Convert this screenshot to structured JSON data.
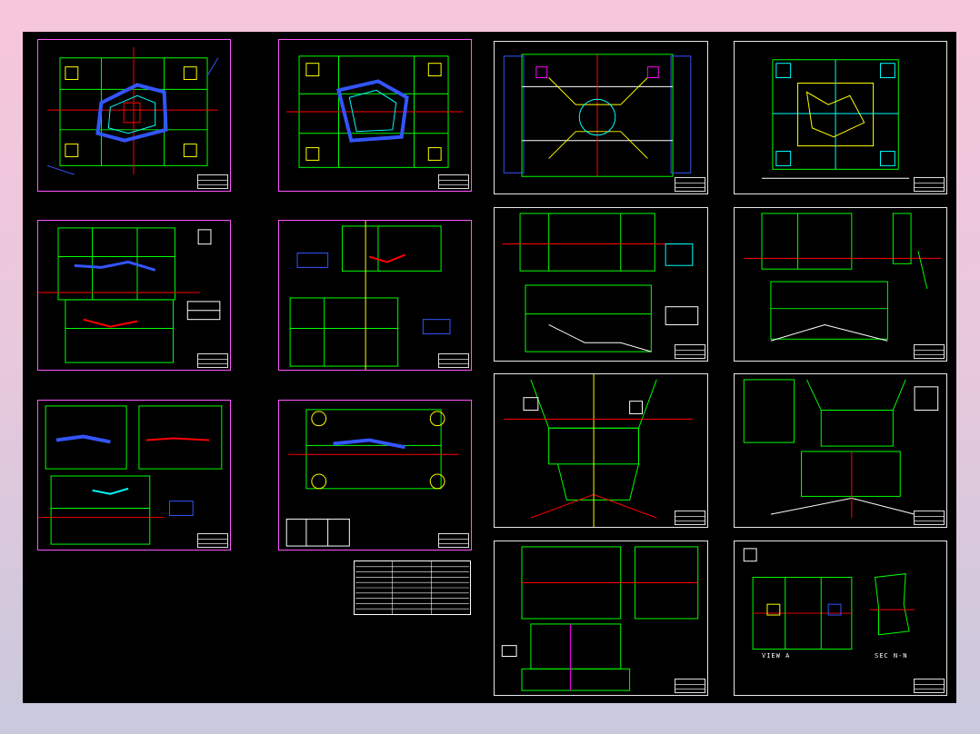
{
  "drawing": {
    "background": "#000000",
    "sheet_border_colors": {
      "magenta": "#ff55ff",
      "white": "#e8e8e8"
    },
    "line_colors": [
      "#00ff00",
      "#ffff00",
      "#00ffff",
      "#ff0000",
      "#3355ff",
      "#ffffff",
      "#ff00ff"
    ],
    "view_labels": {
      "view_a": "VIEW A",
      "sec_nn": "SEC N-N"
    }
  }
}
